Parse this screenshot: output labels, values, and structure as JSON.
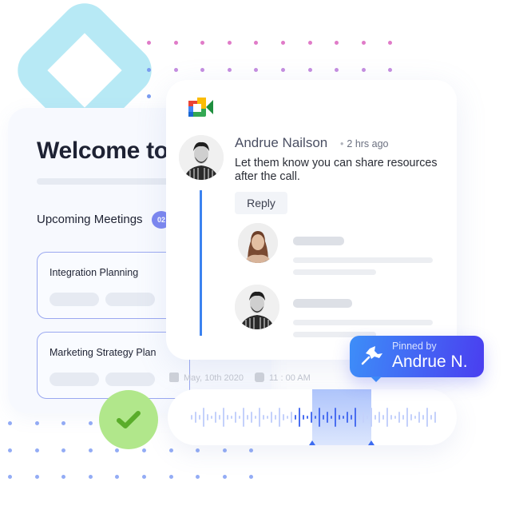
{
  "left_panel": {
    "welcome_title": "Welcome to",
    "section_title": "Upcoming Meetings",
    "meeting_count": "02",
    "meetings": [
      {
        "title": "Integration Planning"
      },
      {
        "title": "Marketing Strategy Plan"
      }
    ],
    "meta": {
      "date_icon": "calendar-icon",
      "date": "May, 10th 2020",
      "time_icon": "clock-icon",
      "time": "11 : 00 AM"
    }
  },
  "chat": {
    "app_icon": "google-meet-icon",
    "comment": {
      "author": "Andrue Nailson",
      "separator": "•",
      "time_ago": "2 hrs ago",
      "message": "Let them know you can share resources after the call.",
      "reply_label": "Reply"
    },
    "replies": [
      {
        "avatar": "woman-avatar"
      },
      {
        "avatar": "man-avatar"
      }
    ]
  },
  "pinned": {
    "icon": "pin-icon",
    "label": "Pinned by",
    "name": "Andrue N."
  },
  "audio": {
    "status_icon": "check-icon",
    "selection_start": 0.44,
    "selection_end": 0.7
  },
  "colors": {
    "accent_blue": "#3c82f0",
    "pinned_gradient_start": "#3d8ef8",
    "pinned_gradient_end": "#4a3ef0",
    "success_green": "#b1e78b",
    "badge_purple": "#7b86f0"
  }
}
